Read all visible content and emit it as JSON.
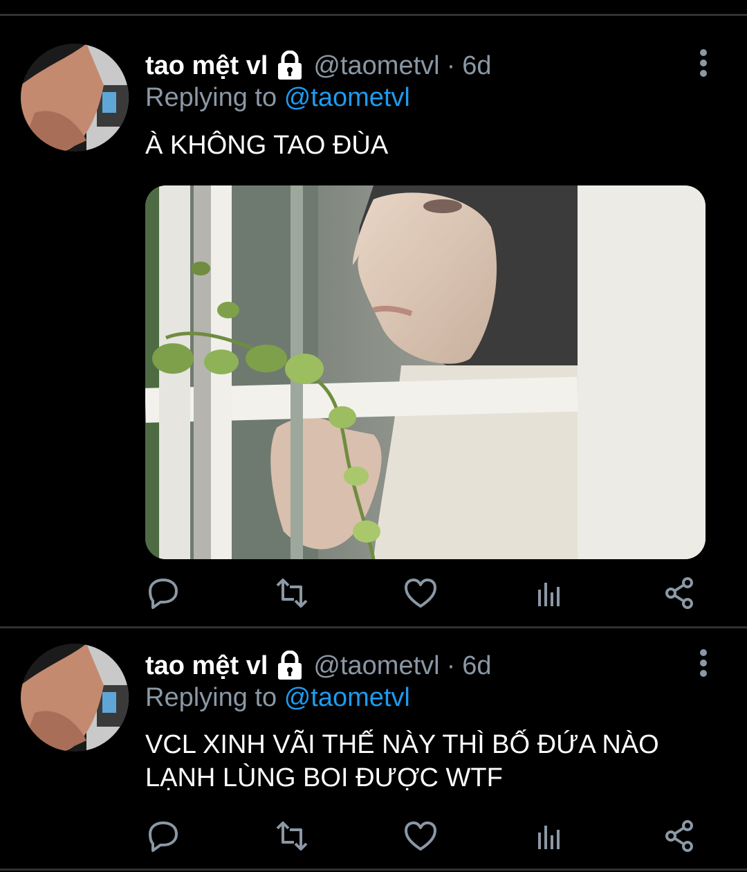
{
  "tweets": [
    {
      "display_name": "tao mệt vl",
      "handle": "@taometvl",
      "separator": "·",
      "time": "6d",
      "replying_label": "Replying to",
      "replying_to": "@taometvl",
      "text": "À KHÔNG TAO ĐÙA",
      "has_media": true,
      "media_icon": "photo-window-rain"
    },
    {
      "display_name": "tao mệt vl",
      "handle": "@taometvl",
      "separator": "·",
      "time": "6d",
      "replying_label": "Replying to",
      "replying_to": "@taometvl",
      "text_lines": [
        "VCL XINH VÃI THẾ NÀY THÌ BỐ ĐỨA NÀO",
        "LẠNH LÙNG BOI ĐƯỢC WTF"
      ],
      "has_media": false
    }
  ],
  "icons": {
    "lock": "lock-icon",
    "more": "more-vertical-icon",
    "reply": "reply-icon",
    "retweet": "retweet-icon",
    "like": "heart-icon",
    "analytics": "analytics-icon",
    "share": "share-icon"
  },
  "colors": {
    "background": "#000000",
    "text": "#ffffff",
    "muted": "#8b98a5",
    "link": "#1d9bf0",
    "divider": "#2f3336"
  }
}
